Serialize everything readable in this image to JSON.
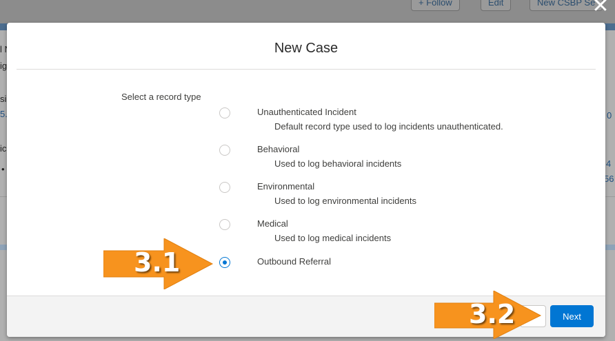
{
  "background": {
    "buttons": [
      "+ Follow",
      "Edit",
      "New CSBP Se"
    ],
    "fragments": [
      "l N",
      "ig",
      "sir",
      "5.",
      "ic",
      "•",
      "4",
      "56",
      "0"
    ]
  },
  "close_icon": "close-icon",
  "modal": {
    "title": "New Case",
    "field_label": "Select a record type",
    "options": [
      {
        "label": "Unauthenticated Incident",
        "description": "Default record type used to log incidents unauthenticated.",
        "selected": false
      },
      {
        "label": "Behavioral",
        "description": "Used to log behavioral incidents",
        "selected": false
      },
      {
        "label": "Environmental",
        "description": "Used to log environmental incidents",
        "selected": false
      },
      {
        "label": "Medical",
        "description": "Used to log medical incidents",
        "selected": false
      },
      {
        "label": "Outbound Referral",
        "description": "",
        "selected": true
      }
    ],
    "footer": {
      "next_label": "Next"
    }
  },
  "annotations": {
    "step1": "3.1",
    "step2": "3.2"
  },
  "colors": {
    "brand_blue": "#0176d3",
    "arrow_orange": "#f7931e"
  }
}
